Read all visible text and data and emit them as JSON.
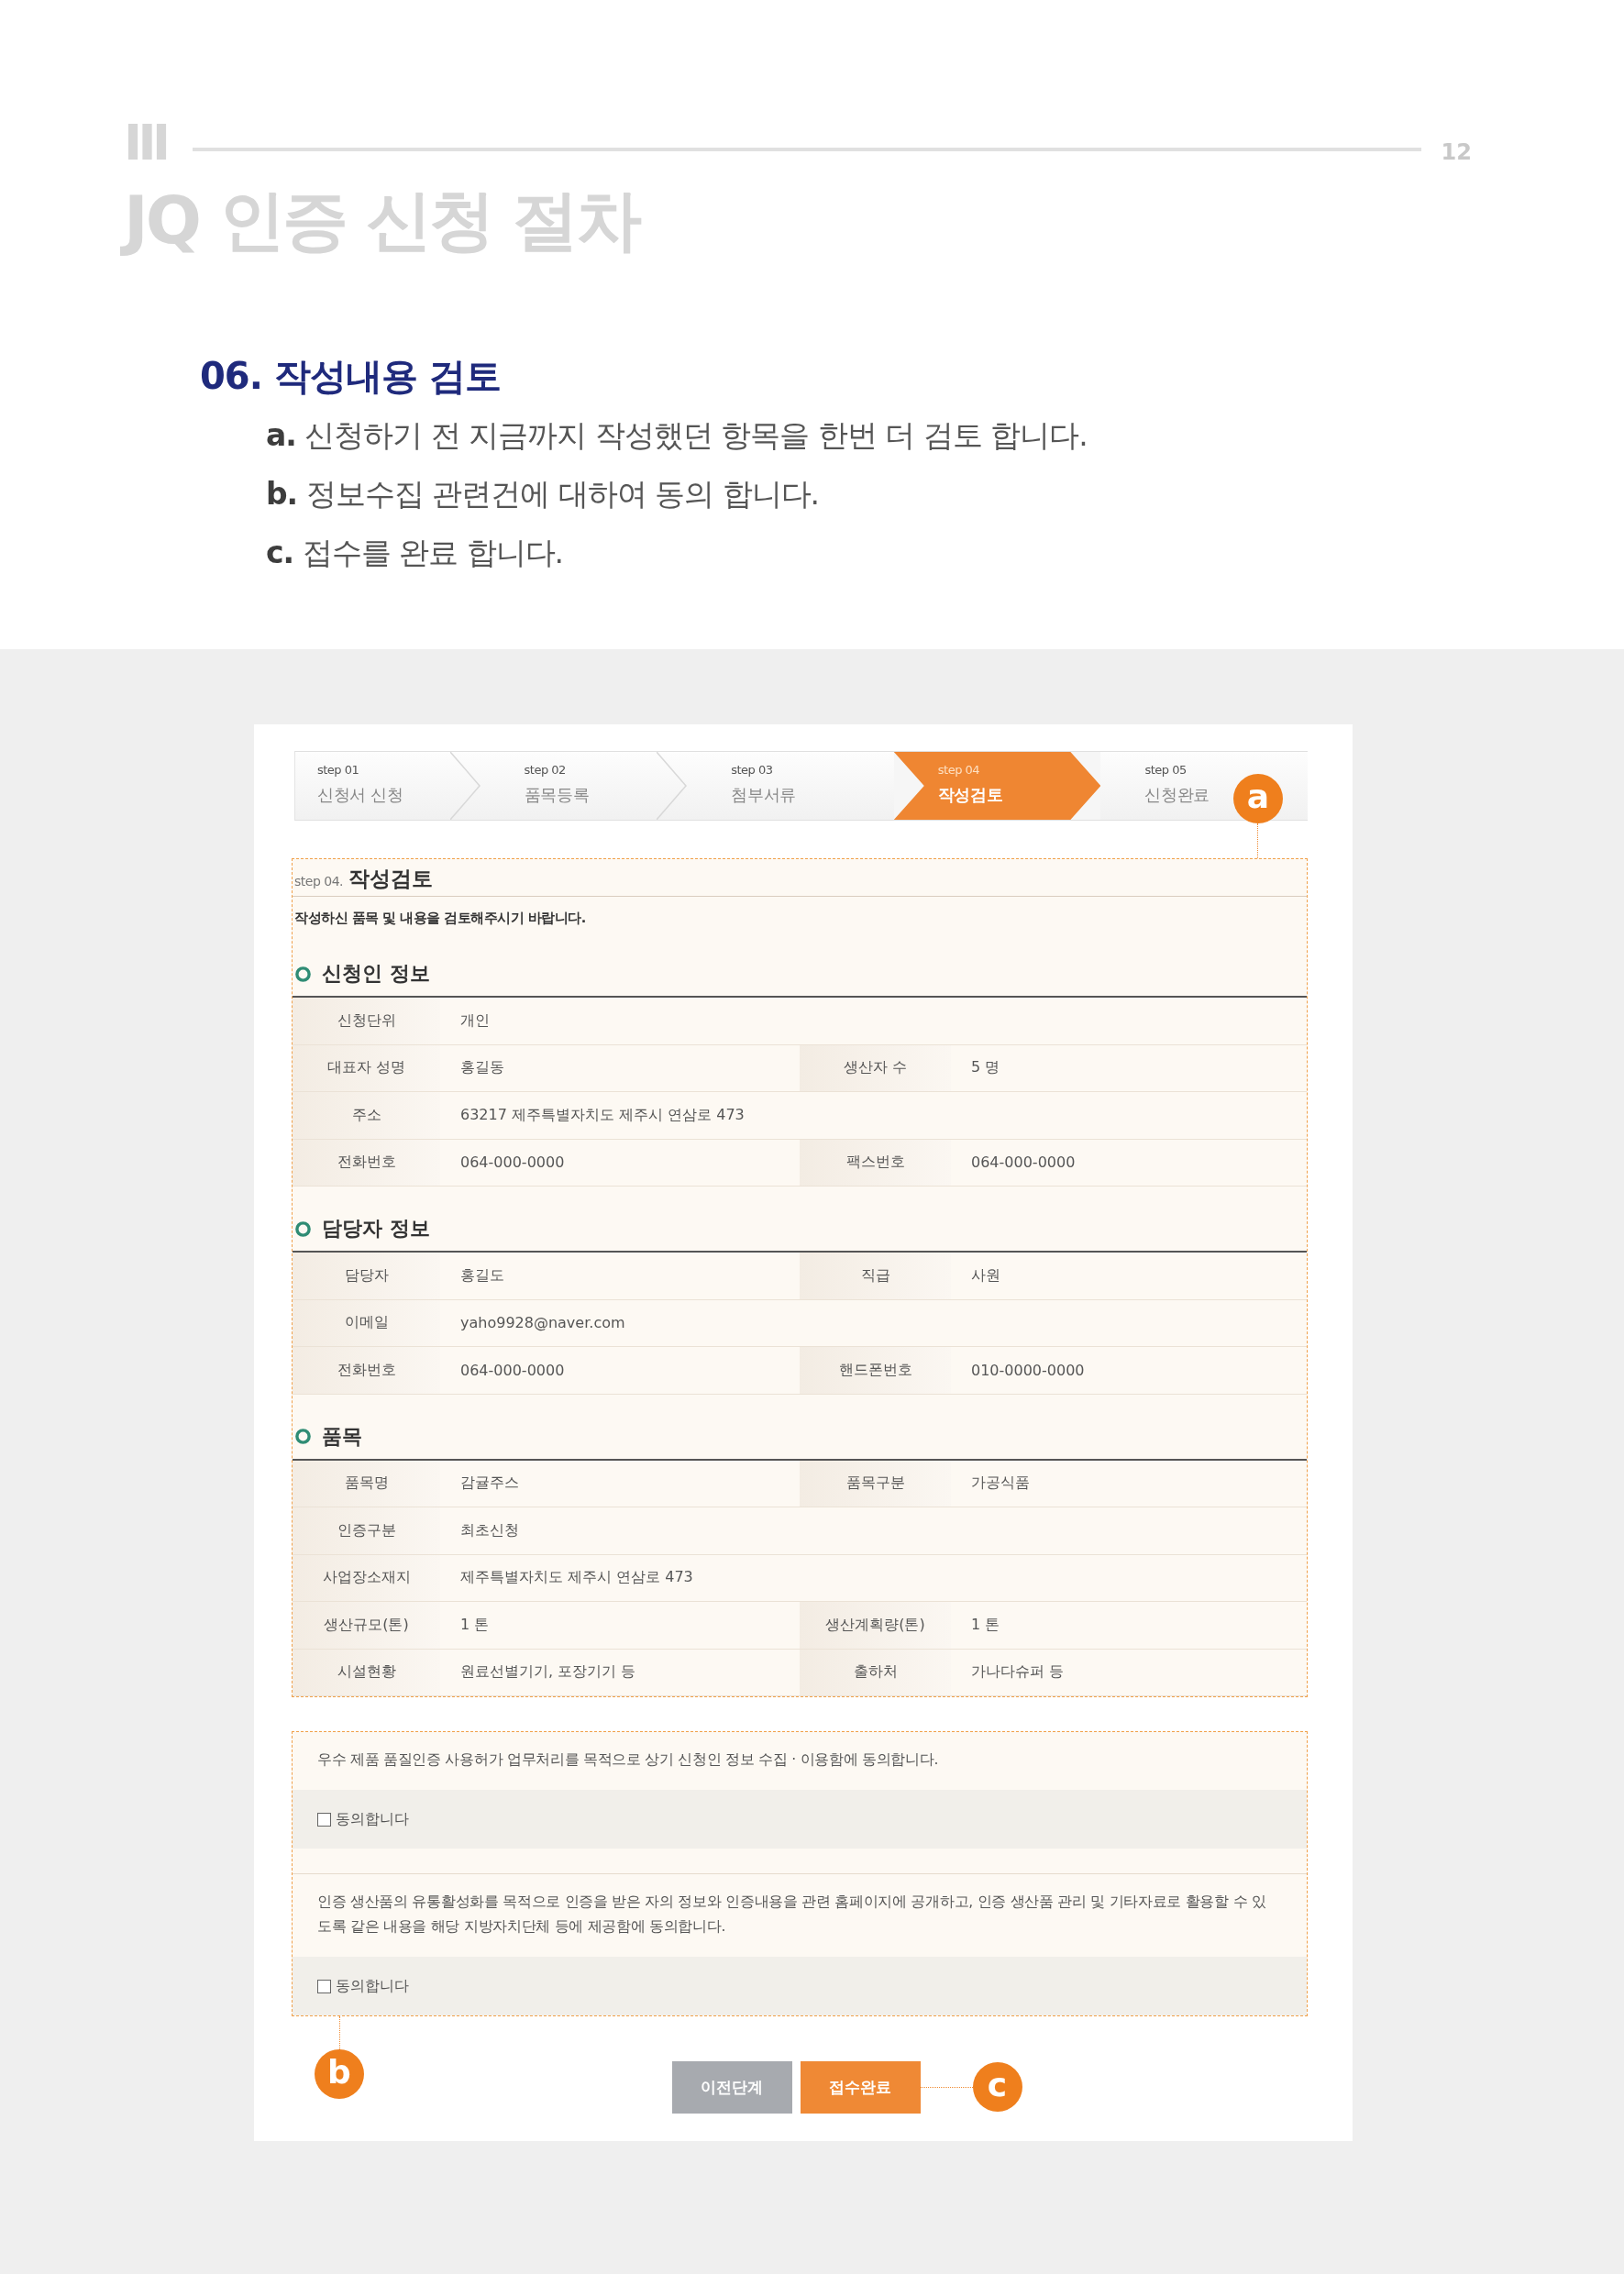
{
  "header": {
    "chapter": "Ⅲ",
    "page": "12",
    "title": "JQ 인증 신청 절차"
  },
  "section": {
    "heading": "06. 작성내용 검토",
    "items": [
      "**a.** 신청하기 전 지금까지 작성했던 항목을 한번 더 검토 합니다.",
      "**b.** 정보수집 관련건에 대하여 동의 합니다.",
      "**c.** 접수를 완료 합니다."
    ]
  },
  "form": {
    "steps": [
      {
        "number": "step 01",
        "label": "신청서 신청",
        "selected": false
      },
      {
        "number": "step 02",
        "label": "품목등록",
        "selected": false
      },
      {
        "number": "step 03",
        "label": "첨부서류",
        "selected": false
      },
      {
        "number": "step 04",
        "label": "작성검토",
        "selected": true
      },
      {
        "number": "step 05",
        "label": "신청완료",
        "selected": false
      }
    ],
    "steps_callout": "a",
    "review": {
      "kicker": "step 04.",
      "title": "작성검토",
      "notice": "작성하신 품목 및 내용을 검토해주시기 바랍니다.",
      "groups": [
        {
          "title": "신청인 정보",
          "rows": [
            [
              {
                "label": "신청단위",
                "value": "개인"
              }
            ],
            [
              {
                "label": "대표자 성명",
                "value": "홍길동"
              },
              {
                "label": "생산자 수",
                "value": "5 명"
              }
            ],
            [
              {
                "label": "주소",
                "value": "63217 제주특별자치도 제주시 연삼로 473"
              }
            ],
            [
              {
                "label": "전화번호",
                "value": "064-000-0000"
              },
              {
                "label": "팩스번호",
                "value": "064-000-0000"
              }
            ]
          ]
        },
        {
          "title": "담당자 정보",
          "rows": [
            [
              {
                "label": "담당자",
                "value": "홍길도"
              },
              {
                "label": "직급",
                "value": "사원"
              }
            ],
            [
              {
                "label": "이메일",
                "value": "yaho9928@naver.com"
              }
            ],
            [
              {
                "label": "전화번호",
                "value": "064-000-0000"
              },
              {
                "label": "핸드폰번호",
                "value": "010-0000-0000"
              }
            ]
          ]
        },
        {
          "title": "품목",
          "rows": [
            [
              {
                "label": "품목명",
                "value": "감귤주스"
              },
              {
                "label": "품목구분",
                "value": "가공식품"
              }
            ],
            [
              {
                "label": "인증구분",
                "value": "최초신청"
              }
            ],
            [
              {
                "label": "사업장소재지",
                "value": "제주특별자치도 제주시 연삼로 473"
              }
            ],
            [
              {
                "label": "생산규모(톤)",
                "value": "1 톤"
              },
              {
                "label": "생산계획량(톤)",
                "value": "1 톤"
              }
            ],
            [
              {
                "label": "시설현황",
                "value": "원료선별기기, 포장기기 등"
              },
              {
                "label": "출하처",
                "value": "가나다슈퍼 등"
              }
            ]
          ]
        }
      ]
    },
    "consents": [
      {
        "text": "우수 제품 품질인증 사용허가 업무처리를 목적으로 상기 신청인 정보 수집 · 이용함에 동의합니다.",
        "label": "동의합니다",
        "checked": false
      },
      {
        "text": "인증 생산품의 유통활성화를 목적으로 인증을 받은 자의 정보와 인증내용을 관련 홈페이지에 공개하고, 인증 생산품 관리 및 기타자료로 활용할 수 있도록 같은 내용을 해당 지방자치단체 등에 제공함에 동의합니다.",
        "label": "동의합니다",
        "checked": false
      }
    ],
    "consents_callout": "b",
    "buttons": [
      {
        "label": "이전단계",
        "kind": "secondary"
      },
      {
        "label": "접수완료",
        "kind": "primary"
      }
    ],
    "buttons_callout": "c"
  }
}
